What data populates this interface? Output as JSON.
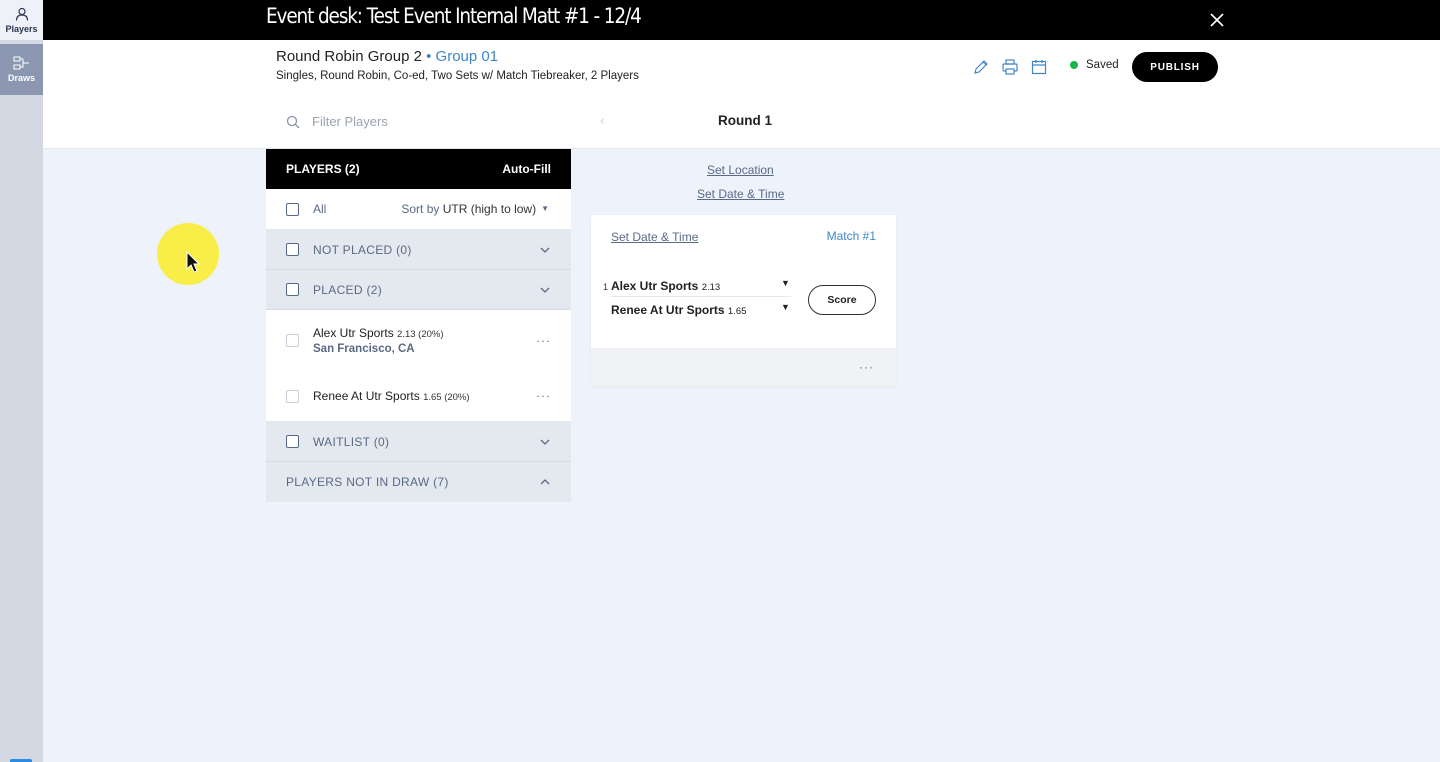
{
  "sidebar": {
    "items": [
      {
        "label": "Players",
        "icon": "user-icon"
      },
      {
        "label": "Draws",
        "icon": "draws-icon"
      }
    ]
  },
  "topbar": {
    "title": "Event desk: Test Event Internal Matt #1 - 12/4"
  },
  "header": {
    "title": "Round Robin Group 2",
    "group": "• Group 01",
    "subtitle": "Singles, Round Robin, Co-ed, Two Sets w/ Match Tiebreaker, 2 Players",
    "saved_label": "Saved",
    "saved_color": "#1db34a",
    "publish_label": "PUBLISH"
  },
  "filter": {
    "placeholder": "Filter Players",
    "value": ""
  },
  "round": {
    "title": "Round 1",
    "set_location": "Set Location",
    "set_date_time": "Set Date & Time"
  },
  "players_panel": {
    "title": "PLAYERS (2)",
    "autofill_label": "Auto-Fill",
    "all_label": "All",
    "sort_prefix": "Sort by",
    "sort_value": "UTR (high to low)",
    "sections": {
      "not_placed": "NOT PLACED (0)",
      "placed": "PLACED (2)",
      "waitlist": "WAITLIST (0)",
      "not_in_draw": "PLAYERS NOT IN DRAW (7)"
    },
    "players": [
      {
        "name": "Alex Utr Sports",
        "utr": "2.13 (20%)",
        "location": "San Francisco, CA"
      },
      {
        "name": "Renee At Utr Sports",
        "utr": "1.65 (20%)",
        "location": ""
      }
    ],
    "more_label": "···"
  },
  "match": {
    "set_date_time": "Set Date & Time",
    "match_label": "Match #1",
    "seed": "1",
    "player1": {
      "name": "Alex Utr Sports",
      "utr": "2.13"
    },
    "player2": {
      "name": "Renee At Utr Sports",
      "utr": "1.65"
    },
    "score_label": "Score",
    "more_label": "···"
  },
  "colors": {
    "accent": "#3f86c8",
    "muted": "#5a6a85",
    "topbar": "#000000",
    "background": "#eef2fa"
  }
}
